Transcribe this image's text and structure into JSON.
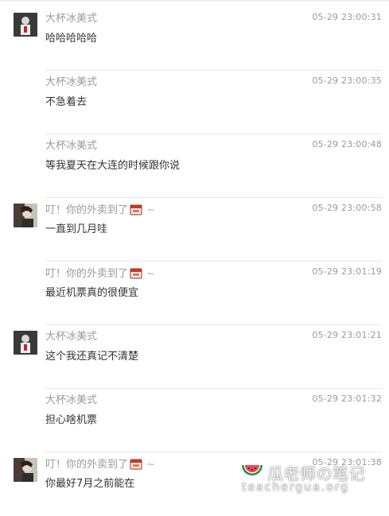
{
  "messages": [
    {
      "user": "大杯冰美式",
      "time": "05-29 23:00:31",
      "text": "哈哈哈哈哈",
      "avatar": "a"
    },
    {
      "user": "大杯冰美式",
      "time": "05-29 23:00:35",
      "text": "不急着去",
      "avatar": ""
    },
    {
      "user": "大杯冰美式",
      "time": "05-29 23:00:48",
      "text": "等我夏天在大连的时候跟你说",
      "avatar": ""
    },
    {
      "user": "叮！你的外卖到了",
      "time": "05-29 23:00:58",
      "text": "一直到几月哇",
      "avatar": "b",
      "sticker": "takeout-box-icon",
      "suffix": "~"
    },
    {
      "user": "叮！你的外卖到了",
      "time": "05-29 23:01:19",
      "text": "最近机票真的很便宜",
      "avatar": "",
      "sticker": "takeout-box-icon",
      "suffix": "~"
    },
    {
      "user": "大杯冰美式",
      "time": "05-29 23:01:21",
      "text": "这个我还真记不清楚",
      "avatar": "a"
    },
    {
      "user": "大杯冰美式",
      "time": "05-29 23:01:32",
      "text": "担心啥机票",
      "avatar": ""
    },
    {
      "user": "叮！你的外卖到了",
      "time": "05-29 23:01:38",
      "text": "你最好7月之前能在",
      "avatar": "b",
      "sticker": "takeout-box-icon",
      "suffix": "~"
    }
  ],
  "watermark": {
    "title": "瓜老师の笔记",
    "url": "teachergua.org",
    "icon": "watermelon-icon"
  }
}
